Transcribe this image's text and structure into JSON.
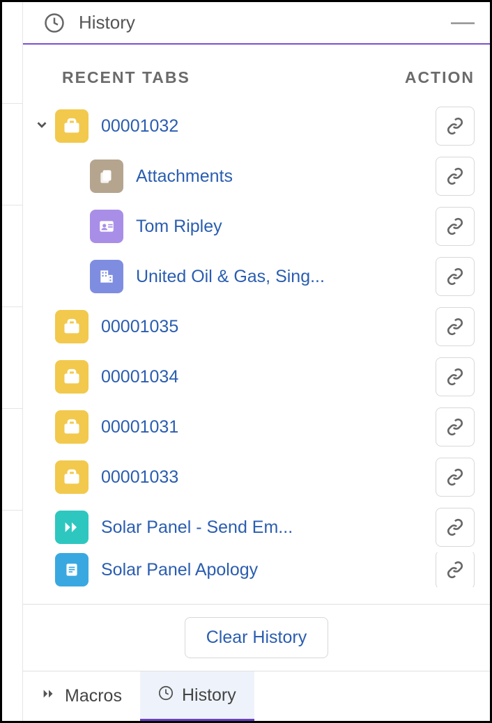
{
  "header": {
    "title": "History"
  },
  "columns": {
    "recent": "RECENT TABS",
    "action": "ACTION"
  },
  "items": [
    {
      "icon": "case",
      "label": "00001032",
      "expanded": true,
      "children": [
        {
          "icon": "file",
          "label": "Attachments"
        },
        {
          "icon": "contact",
          "label": "Tom Ripley"
        },
        {
          "icon": "account",
          "label": "United Oil & Gas, Sing..."
        }
      ]
    },
    {
      "icon": "case",
      "label": "00001035"
    },
    {
      "icon": "case",
      "label": "00001034"
    },
    {
      "icon": "case",
      "label": "00001031"
    },
    {
      "icon": "case",
      "label": "00001033"
    },
    {
      "icon": "macro",
      "label": "Solar Panel - Send Em..."
    },
    {
      "icon": "doc",
      "label": "Solar Panel Apology"
    }
  ],
  "footer": {
    "clear": "Clear History"
  },
  "tabs": {
    "macros": "Macros",
    "history": "History"
  }
}
